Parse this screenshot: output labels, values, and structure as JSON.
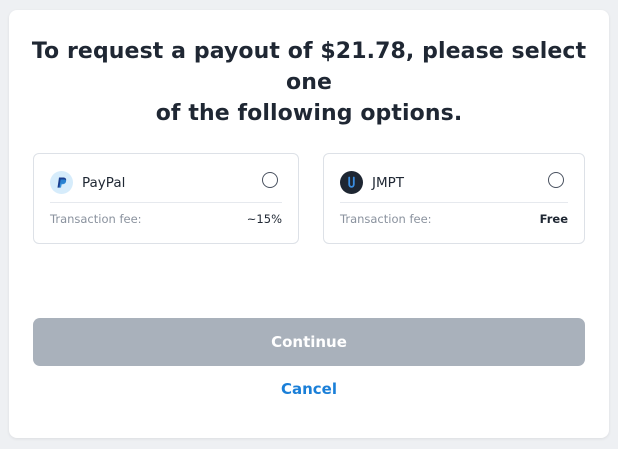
{
  "header": {
    "title_line1": "To request a payout of $21.78, please select one",
    "title_line2": "of the following options."
  },
  "options": [
    {
      "name": "PayPal",
      "icon": "paypal-icon",
      "fee_label": "Transaction fee:",
      "fee_value": "~15%",
      "selected": false
    },
    {
      "name": "JMPT",
      "icon": "jmpt-icon",
      "fee_label": "Transaction fee:",
      "fee_value": "Free",
      "selected": false
    }
  ],
  "actions": {
    "continue_label": "Continue",
    "cancel_label": "Cancel"
  },
  "colors": {
    "primary_text": "#1f2733",
    "muted_text": "#8a929e",
    "button_disabled": "#a9b1bb",
    "link": "#1a7fd8"
  }
}
